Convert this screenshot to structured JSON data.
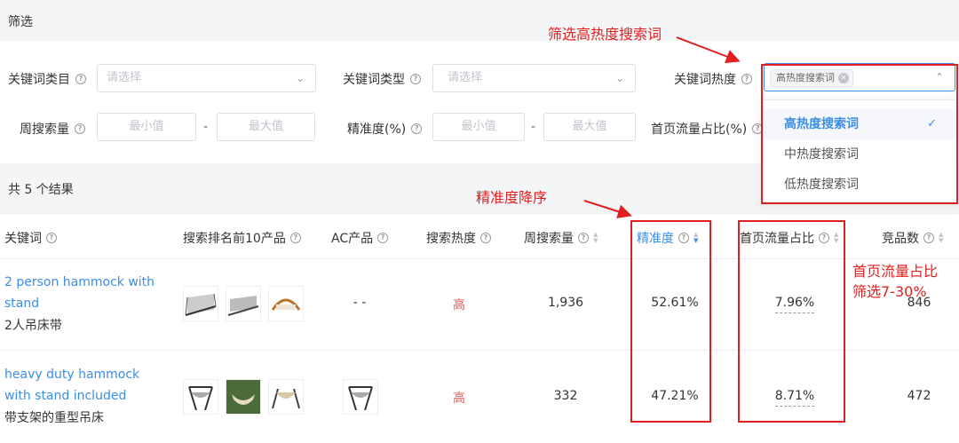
{
  "filter": {
    "title": "筛选",
    "keyword_category_label": "关键词类目",
    "keyword_category_placeholder": "请选择",
    "keyword_type_label": "关键词类型",
    "keyword_type_placeholder": "请选择",
    "keyword_heat_label": "关键词热度",
    "keyword_heat_tag": "高热度搜索词",
    "weekly_search_label": "周搜索量",
    "min_placeholder": "最小值",
    "max_placeholder": "最大值",
    "range_dash": "-",
    "precision_label": "精准度(%)",
    "traffic_share_label": "首页流量占比(%)"
  },
  "dropdown": {
    "options": [
      {
        "label": "高热度搜索词",
        "selected": true
      },
      {
        "label": "中热度搜索词",
        "selected": false
      },
      {
        "label": "低热度搜索词",
        "selected": false
      }
    ]
  },
  "results": {
    "summary": "共 5 个结果"
  },
  "table": {
    "headers": {
      "keyword": "关键词",
      "top10": "搜索排名前10产品",
      "ac": "AC产品",
      "heat": "搜索热度",
      "weekly": "周搜索量",
      "precision": "精准度",
      "traffic": "首页流量占比",
      "competitors": "竞品数"
    },
    "rows": [
      {
        "keyword_en_line1": "2 person hammock with",
        "keyword_en_line2": "stand",
        "keyword_cn": "2人吊床带",
        "ac": "- -",
        "heat": "高",
        "weekly": "1,936",
        "precision": "52.61%",
        "traffic": "7.96%",
        "competitors": "846"
      },
      {
        "keyword_en_line1": "heavy duty hammock",
        "keyword_en_line2": "with stand included",
        "keyword_cn": "带支架的重型吊床",
        "ac": "",
        "heat": "高",
        "weekly": "332",
        "precision": "47.21%",
        "traffic": "8.71%",
        "competitors": "472"
      }
    ]
  },
  "annotations": {
    "filter_heat": "筛选高热度搜索词",
    "precision_desc": "精准度降序",
    "traffic_line1": "首页流量占比",
    "traffic_line2": "筛选7-30%"
  },
  "colors": {
    "accent": "#3a8ee6",
    "annotation_red": "#e02020",
    "heat_high": "#e45a5a"
  }
}
